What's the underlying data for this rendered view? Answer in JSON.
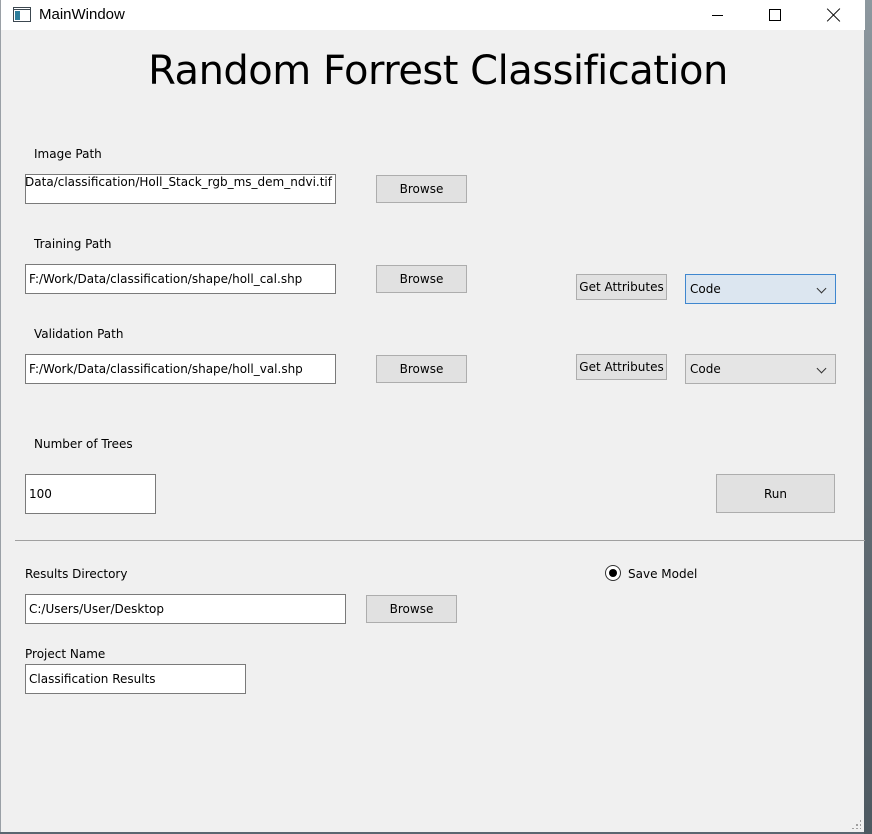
{
  "window": {
    "title": "MainWindow"
  },
  "heading": "Random Forrest Classification",
  "image_path": {
    "label": "Image Path",
    "value": "F:/Work/Data/classification/Holl_Stack_rgb_ms_dem_ndvi.tif",
    "browse": "Browse"
  },
  "training_path": {
    "label": "Training Path",
    "value": "F:/Work/Data/classification/shape/holl_cal.shp",
    "browse": "Browse",
    "get_attributes": "Get Attributes",
    "attribute": "Code"
  },
  "validation_path": {
    "label": "Validation Path",
    "value": "F:/Work/Data/classification/shape/holl_val.shp",
    "browse": "Browse",
    "get_attributes": "Get Attributes",
    "attribute": "Code"
  },
  "trees": {
    "label": "Number of Trees",
    "value": "100"
  },
  "run": "Run",
  "results": {
    "label": "Results Directory",
    "value": "C:/Users/User/Desktop",
    "browse": "Browse"
  },
  "save_model": {
    "label": "Save Model",
    "checked": true
  },
  "project": {
    "label": "Project Name",
    "value": "Classification Results"
  },
  "icons": {
    "app": "app-window-icon",
    "minimize": "minimize-icon",
    "maximize": "maximize-icon",
    "close": "close-icon",
    "dropdown": "chevron-down-icon",
    "grip": "resize-grip-icon"
  }
}
